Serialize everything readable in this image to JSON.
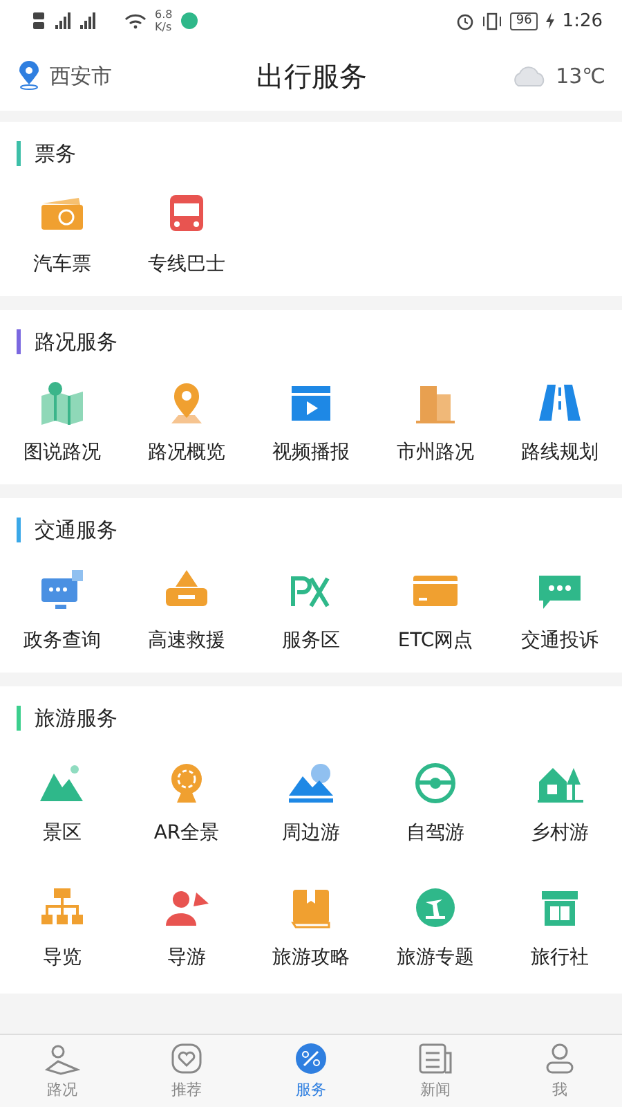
{
  "status_bar": {
    "speed_value": "6.8",
    "speed_unit": "K/s",
    "battery": "96",
    "time": "1:26"
  },
  "header": {
    "city": "西安市",
    "title": "出行服务",
    "temperature": "13℃"
  },
  "sections": [
    {
      "title": "票务",
      "color": "#3dbfa8",
      "items": [
        {
          "label": "汽车票"
        },
        {
          "label": "专线巴士"
        }
      ]
    },
    {
      "title": "路况服务",
      "color": "#7b68e0",
      "items": [
        {
          "label": "图说路况"
        },
        {
          "label": "路况概览"
        },
        {
          "label": "视频播报"
        },
        {
          "label": "市州路况"
        },
        {
          "label": "路线规划"
        }
      ]
    },
    {
      "title": "交通服务",
      "color": "#3aa8e8",
      "items": [
        {
          "label": "政务查询"
        },
        {
          "label": "高速救援"
        },
        {
          "label": "服务区"
        },
        {
          "label": "ETC网点"
        },
        {
          "label": "交通投诉"
        }
      ]
    },
    {
      "title": "旅游服务",
      "color": "#3ccf8e",
      "items": [
        {
          "label": "景区"
        },
        {
          "label": "AR全景"
        },
        {
          "label": "周边游"
        },
        {
          "label": "自驾游"
        },
        {
          "label": "乡村游"
        },
        {
          "label": "导览"
        },
        {
          "label": "导游"
        },
        {
          "label": "旅游攻略"
        },
        {
          "label": "旅游专题"
        },
        {
          "label": "旅行社"
        }
      ]
    }
  ],
  "nav": [
    {
      "label": "路况",
      "selected": false
    },
    {
      "label": "推荐",
      "selected": false
    },
    {
      "label": "服务",
      "selected": true
    },
    {
      "label": "新闻",
      "selected": false
    },
    {
      "label": "我",
      "selected": false
    }
  ]
}
